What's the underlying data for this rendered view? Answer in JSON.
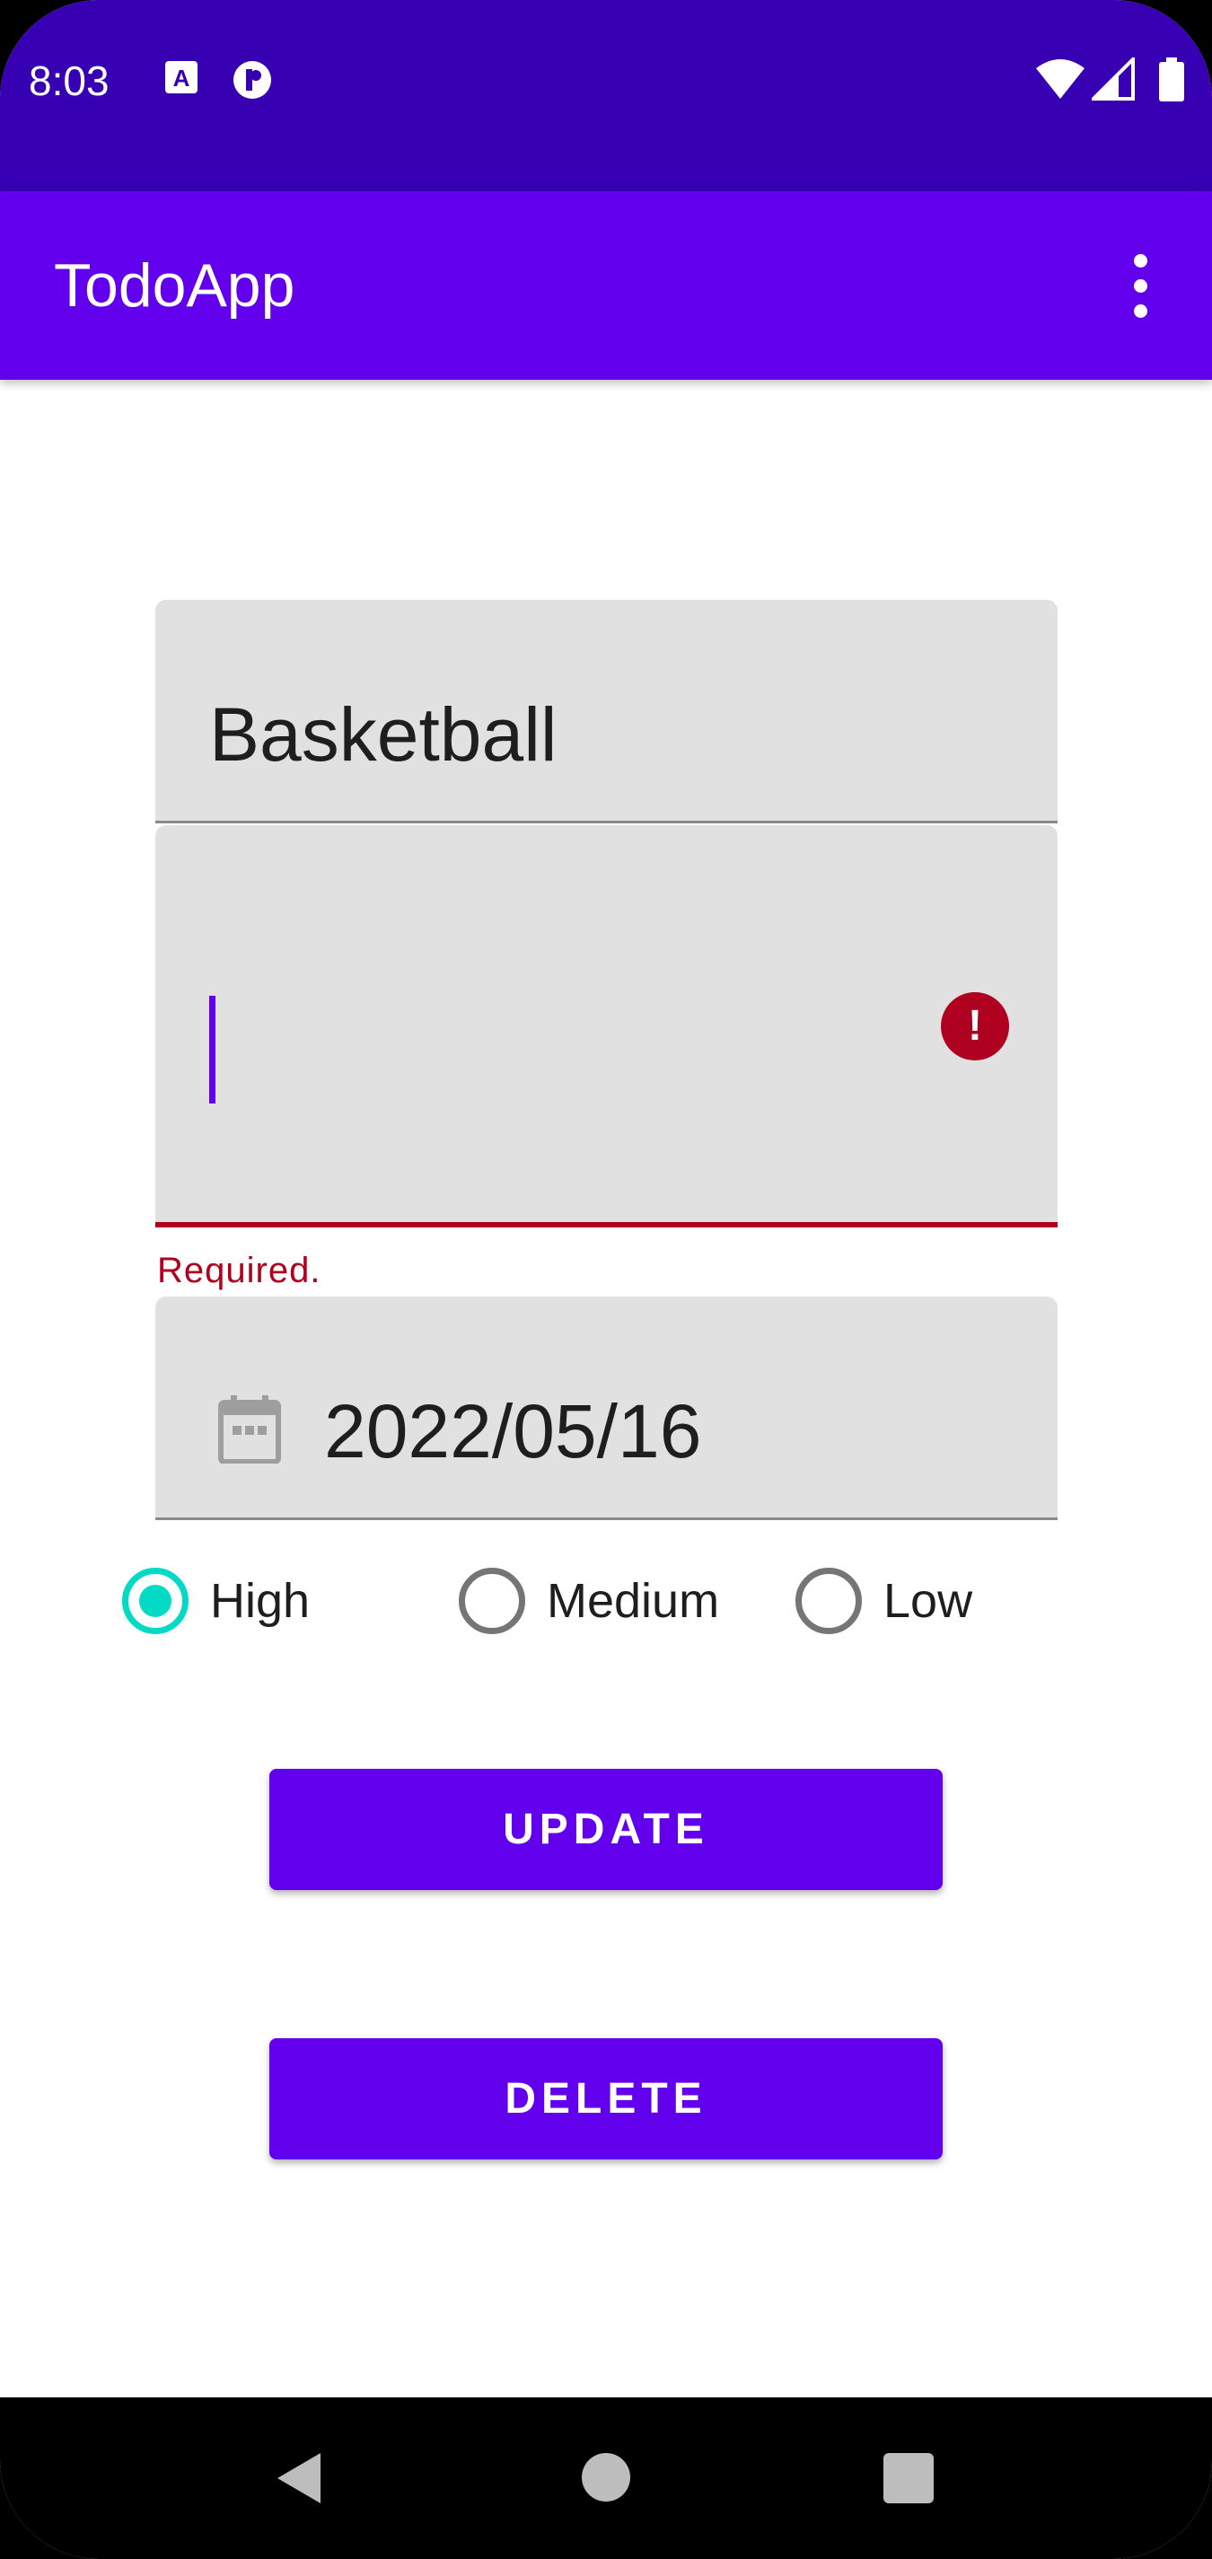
{
  "status_bar": {
    "time": "8:03",
    "icons": [
      "text-a-icon",
      "circle-p-icon",
      "wifi-icon",
      "signal-icon",
      "battery-icon"
    ]
  },
  "app_bar": {
    "title": "TodoApp",
    "menu_icon": "more-vert-icon"
  },
  "form": {
    "title_value": "Basketball",
    "description_value": "",
    "description_error": "Required.",
    "date_value": "2022/05/16",
    "date_icon": "calendar-icon",
    "priority": {
      "options": [
        "High",
        "Medium",
        "Low"
      ],
      "selected": "High"
    }
  },
  "buttons": {
    "update_label": "UPDATE",
    "delete_label": "DELETE"
  },
  "nav_bar": {
    "icons": [
      "back-icon",
      "home-icon",
      "recents-icon"
    ]
  },
  "colors": {
    "status_bar": "#3700b3",
    "primary": "#6200ee",
    "accent": "#03dac5",
    "error": "#b00020"
  }
}
